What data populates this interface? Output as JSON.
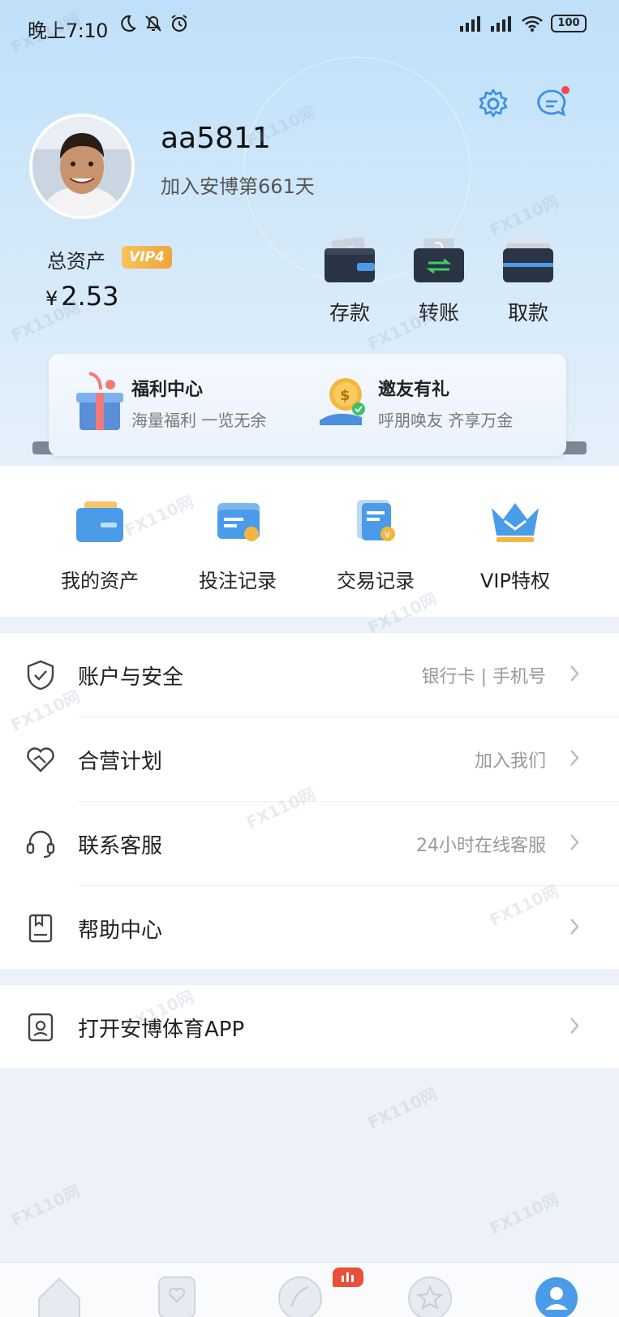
{
  "status_bar": {
    "time": "晚上7:10",
    "battery": "100"
  },
  "user": {
    "username": "aa5811",
    "joined_text": "加入安博第661天"
  },
  "assets": {
    "label": "总资产",
    "vip_level": "VIP4",
    "currency": "¥",
    "balance": "2.53"
  },
  "actions": [
    {
      "label": "存款"
    },
    {
      "label": "转账"
    },
    {
      "label": "取款"
    }
  ],
  "promos": [
    {
      "title": "福利中心",
      "subtitle": "海量福利 一览无余"
    },
    {
      "title": "邀友有礼",
      "subtitle": "呼朋唤友 齐享万金"
    }
  ],
  "quick_links": [
    {
      "label": "我的资产"
    },
    {
      "label": "投注记录"
    },
    {
      "label": "交易记录"
    },
    {
      "label": "VIP特权"
    }
  ],
  "menu": [
    {
      "title": "账户与安全",
      "sub": "银行卡 | 手机号"
    },
    {
      "title": "合营计划",
      "sub": "加入我们"
    },
    {
      "title": "联系客服",
      "sub": "24小时在线客服"
    },
    {
      "title": "帮助中心",
      "sub": ""
    }
  ],
  "app_link": {
    "title": "打开安博体育APP"
  },
  "watermark": "FX110网",
  "colors": {
    "accent": "#4a9ce8",
    "vip": "#f0a43a",
    "badge_red": "#e8503a"
  }
}
